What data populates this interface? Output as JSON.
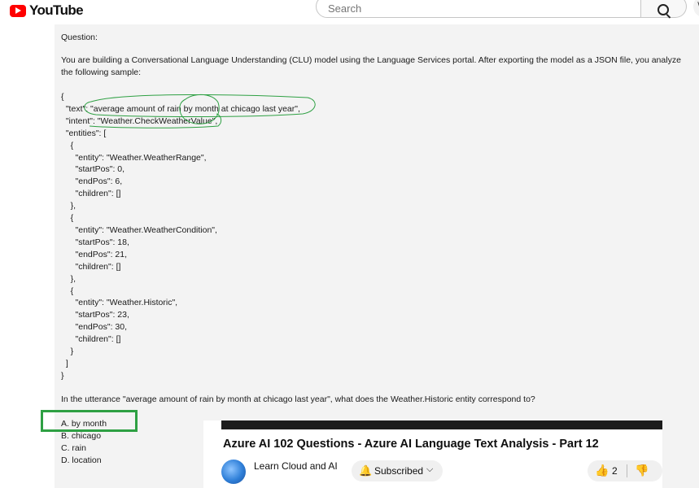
{
  "header": {
    "logo_text": "YouTube",
    "search_placeholder": "Search"
  },
  "slide": {
    "question_label": "Question:",
    "intro": "You are building a Conversational Language Understanding (CLU) model using the Language Services portal. After exporting the model as a JSON file, you analyze the following sample:",
    "json_lines": [
      "{",
      "  \"text\": \"average amount of rain by month at chicago last year\",",
      "  \"intent\": \"Weather.CheckWeatherValue\",",
      "  \"entities\": [",
      "    {",
      "      \"entity\": \"Weather.WeatherRange\",",
      "      \"startPos\": 0,",
      "      \"endPos\": 6,",
      "      \"children\": []",
      "    },",
      "    {",
      "      \"entity\": \"Weather.WeatherCondition\",",
      "      \"startPos\": 18,",
      "      \"endPos\": 21,",
      "      \"children\": []",
      "    },",
      "    {",
      "      \"entity\": \"Weather.Historic\",",
      "      \"startPos\": 23,",
      "      \"endPos\": 30,",
      "      \"children\": []",
      "    }",
      "  ]",
      "}"
    ],
    "question": "In the utterance \"average amount of rain by month at chicago last year\", what does the Weather.Historic entity correspond to?",
    "options": [
      "A. by month",
      "B. chicago",
      "C. rain",
      "D. location"
    ]
  },
  "card": {
    "title": "Azure AI 102 Questions - Azure AI Language Text Analysis - Part 12",
    "channel_name": "Learn Cloud and AI",
    "subscribe_label": "Subscribed",
    "like_count": "2"
  },
  "colors": {
    "brand_red": "#ff0000",
    "annotation_green": "#2ea043",
    "video_bg": "#f3f3f3"
  }
}
